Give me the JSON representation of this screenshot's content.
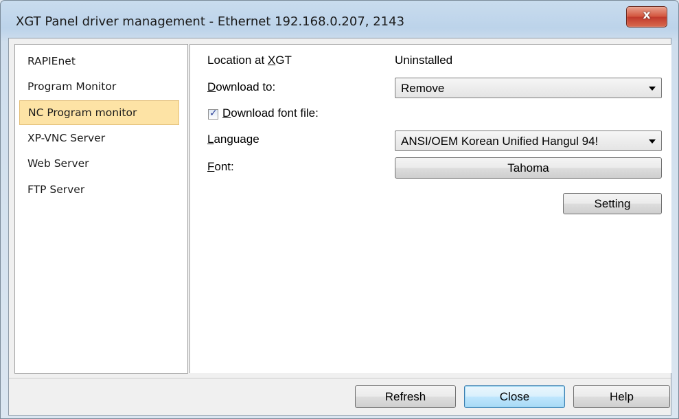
{
  "window": {
    "title": "XGT Panel driver management - Ethernet 192.168.0.207, 2143",
    "close_glyph": "x"
  },
  "sidebar": {
    "items": [
      {
        "label": "RAPIEnet"
      },
      {
        "label": "Program Monitor"
      },
      {
        "label": "NC Program monitor"
      },
      {
        "label": "XP-VNC Server"
      },
      {
        "label": "Web Server"
      },
      {
        "label": "FTP Server"
      }
    ],
    "selected_index": 2
  },
  "form": {
    "location_label_pre": "Location at ",
    "location_label_key": "X",
    "location_label_post": "GT",
    "location_value": "Uninstalled",
    "download_to_key": "D",
    "download_to_rest": "ownload to:",
    "download_to_value": "Remove",
    "download_font_checked": true,
    "download_font_key": "D",
    "download_font_rest": "ownload font file:",
    "language_key": "L",
    "language_rest": "anguage",
    "language_value": "ANSI/OEM Korean Unified Hangul 94!",
    "font_key": "F",
    "font_rest": "ont:",
    "font_button": "Tahoma",
    "setting_button": "Setting"
  },
  "footer": {
    "refresh": "Refresh",
    "close": "Close",
    "help": "Help"
  },
  "colors": {
    "selected_bg": "#fde3a5",
    "close_red": "#c0392b",
    "default_button": "#bee6fd"
  }
}
